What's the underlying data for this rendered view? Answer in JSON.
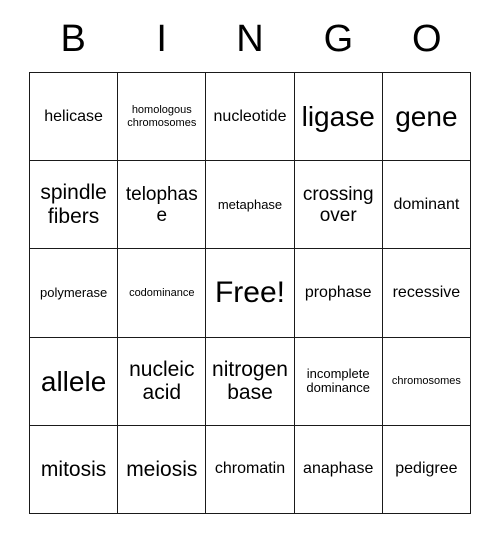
{
  "card": {
    "title_letters": [
      "B",
      "I",
      "N",
      "G",
      "O"
    ],
    "free_space_label": "Free!",
    "colors": {
      "background": "#ffffff",
      "border": "#1a1a1a",
      "text": "#000000"
    },
    "grid": {
      "columns": 5,
      "rows": 5,
      "cells": [
        [
          {
            "label": "helicase",
            "size": "md"
          },
          {
            "label": "homologous\nchromosomes",
            "size": "xs"
          },
          {
            "label": "nucleotide",
            "size": "md"
          },
          {
            "label": "ligase",
            "size": "xxl"
          },
          {
            "label": "gene",
            "size": "xxl"
          }
        ],
        [
          {
            "label": "spindle\nfibers",
            "size": "xl"
          },
          {
            "label": "telophase",
            "size": "lg"
          },
          {
            "label": "metaphase",
            "size": "sm"
          },
          {
            "label": "crossing\nover",
            "size": "lg"
          },
          {
            "label": "dominant",
            "size": "md"
          }
        ],
        [
          {
            "label": "polymerase",
            "size": "sm"
          },
          {
            "label": "codominance",
            "size": "xs"
          },
          {
            "label": "Free!",
            "size": "free"
          },
          {
            "label": "prophase",
            "size": "md"
          },
          {
            "label": "recessive",
            "size": "md"
          }
        ],
        [
          {
            "label": "allele",
            "size": "xxl"
          },
          {
            "label": "nucleic\nacid",
            "size": "xl"
          },
          {
            "label": "nitrogen\nbase",
            "size": "xl"
          },
          {
            "label": "incomplete\ndominance",
            "size": "sm"
          },
          {
            "label": "chromosomes",
            "size": "xs"
          }
        ],
        [
          {
            "label": "mitosis",
            "size": "xl"
          },
          {
            "label": "meiosis",
            "size": "xl"
          },
          {
            "label": "chromatin",
            "size": "md"
          },
          {
            "label": "anaphase",
            "size": "md"
          },
          {
            "label": "pedigree",
            "size": "md"
          }
        ]
      ]
    }
  }
}
